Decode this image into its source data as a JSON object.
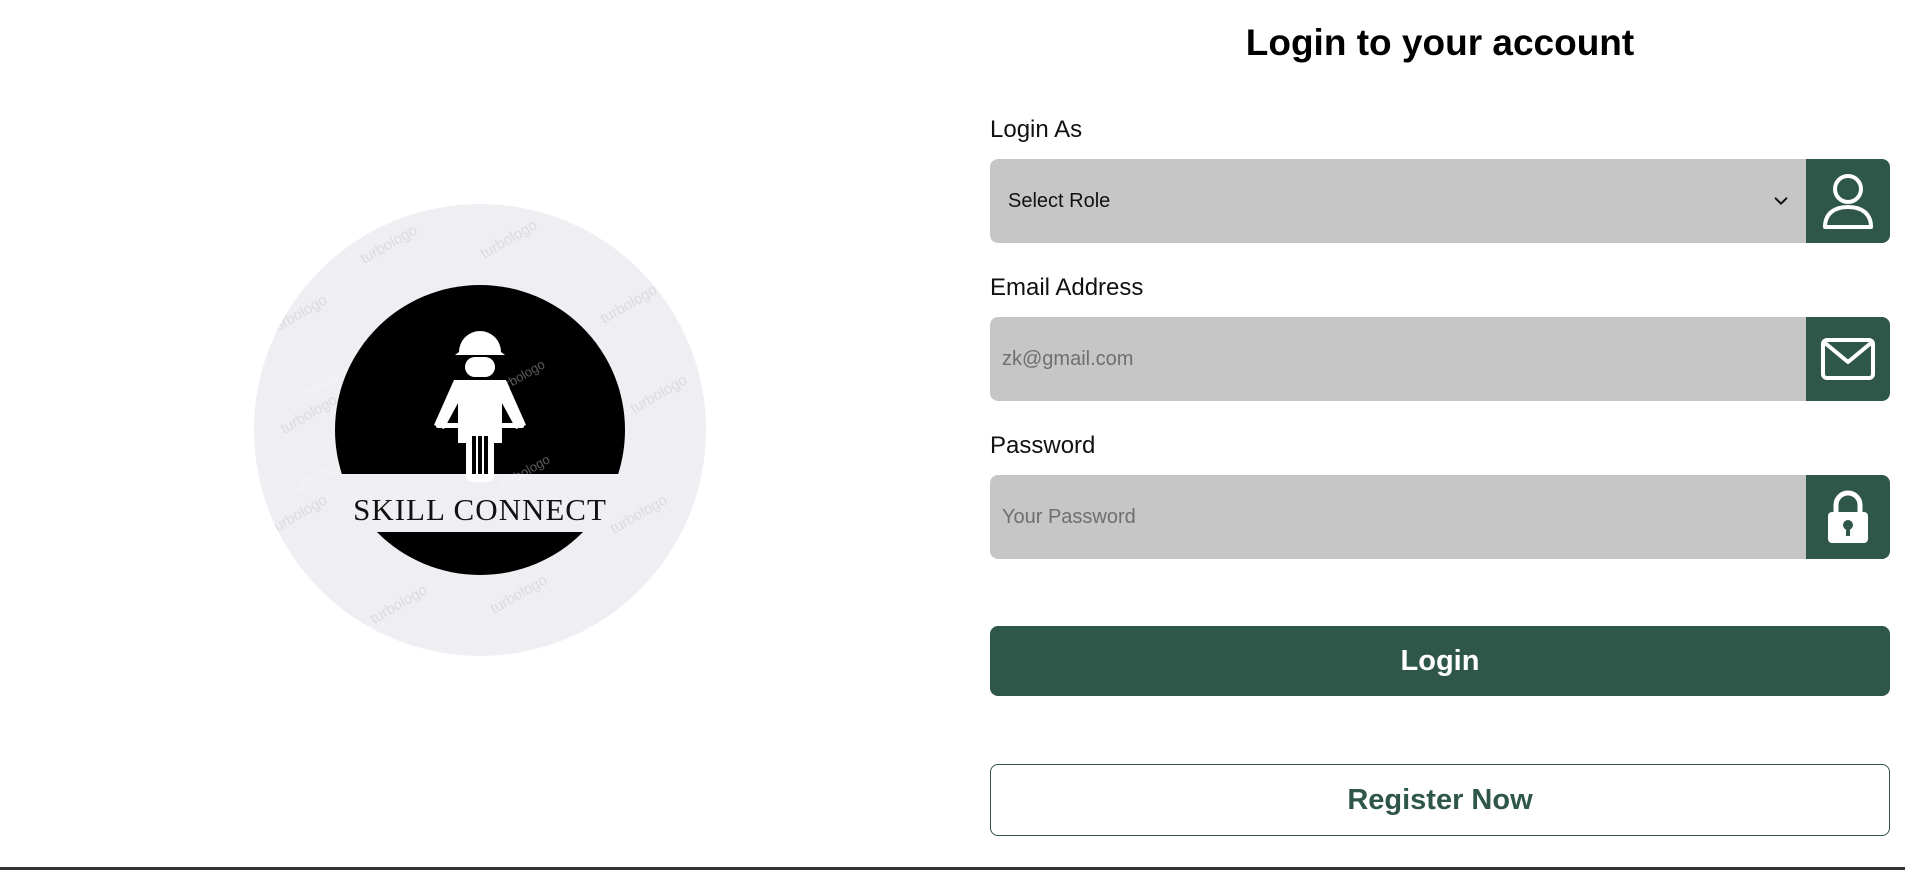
{
  "logo": {
    "text": "SKILL CONNECT",
    "watermark": "turbologo",
    "icon": "worker-on-motorbike-icon",
    "colors": {
      "badge_bg": "#efeef2",
      "circle": "#000000",
      "text": "#111111"
    }
  },
  "form": {
    "title": "Login to your account",
    "role": {
      "label": "Login As",
      "selected": "Select Role",
      "icon": "user-icon"
    },
    "email": {
      "label": "Email Address",
      "placeholder": "zk@gmail.com",
      "value": "",
      "icon": "mail-icon"
    },
    "password": {
      "label": "Password",
      "placeholder": "Your Password",
      "value": "",
      "icon": "lock-icon"
    },
    "login_label": "Login",
    "register_label": "Register Now"
  },
  "colors": {
    "accent": "#2e574a",
    "field_bg": "#c6c6c6",
    "page_bg": "#ffffff"
  }
}
